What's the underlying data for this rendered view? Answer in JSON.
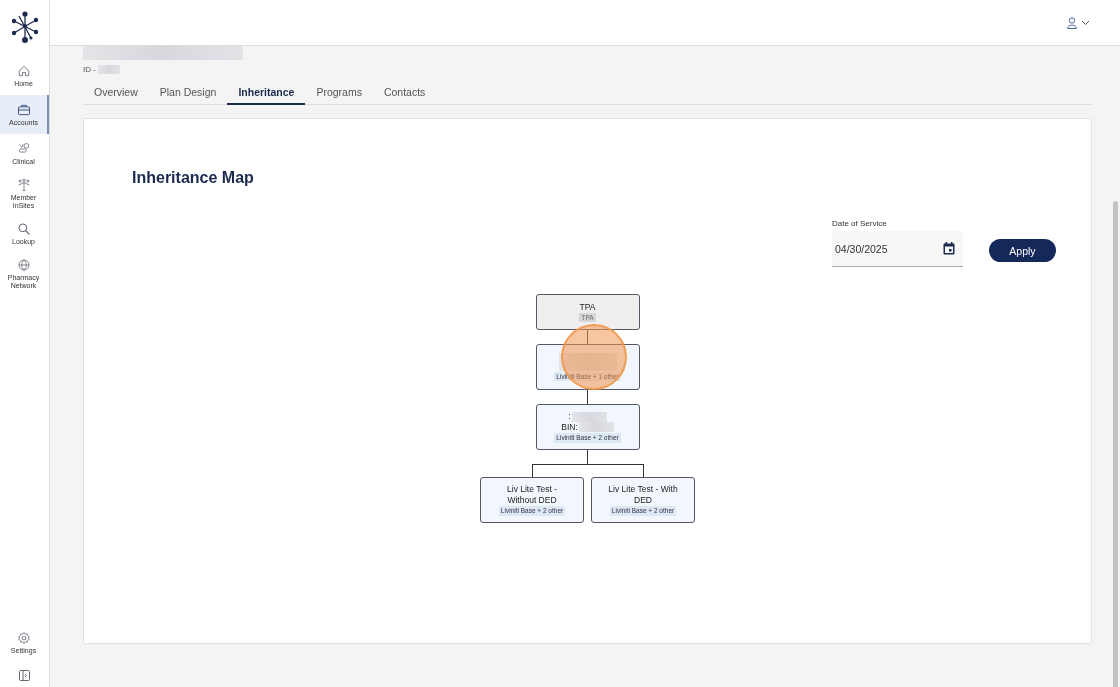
{
  "sidebar": {
    "items": [
      {
        "label": "Home",
        "selected": false
      },
      {
        "label": "Accounts",
        "selected": true
      },
      {
        "label": "Clinical",
        "selected": false
      },
      {
        "label": "Member InSites",
        "selected": false
      },
      {
        "label": "Lookup",
        "selected": false
      },
      {
        "label": "Pharmacy Network",
        "selected": false
      }
    ],
    "bottom_items": [
      {
        "label": "Settings",
        "selected": false
      }
    ]
  },
  "header": {
    "id_label": "ID -"
  },
  "tabs": [
    {
      "label": "Overview",
      "selected": false
    },
    {
      "label": "Plan Design",
      "selected": false
    },
    {
      "label": "Inheritance",
      "selected": true
    },
    {
      "label": "Programs",
      "selected": false
    },
    {
      "label": "Contacts",
      "selected": false
    }
  ],
  "map": {
    "title": "Inheritance Map",
    "date_field": {
      "label": "Date of Service",
      "value": "04/30/2025"
    },
    "apply_button": "Apply",
    "tree": {
      "kind": "group",
      "lines": [
        {
          "text": "TPA",
          "redacted": false
        }
      ],
      "tag": "TPA",
      "children": [
        {
          "kind": "plan",
          "lines": [
            {
              "redacted": true
            }
          ],
          "tag": "Liviniti Base + 1 other",
          "highlighted": true,
          "children": [
            {
              "kind": "plan",
              "lines": [
                {
                  "text": ":",
                  "redacted": true
                },
                {
                  "text": "BIN:",
                  "redacted": true
                }
              ],
              "tag": "Liviniti Base + 2 other",
              "children": [
                {
                  "kind": "plan",
                  "lines": [
                    {
                      "text": "Liv Lite Test - Without DED",
                      "redacted": false
                    }
                  ],
                  "tag": "Liviniti Base + 2 other"
                },
                {
                  "kind": "plan",
                  "lines": [
                    {
                      "text": "Liv Lite Test - With DED",
                      "redacted": false
                    }
                  ],
                  "tag": "Liviniti Base + 2 other"
                }
              ]
            }
          ]
        }
      ]
    }
  }
}
